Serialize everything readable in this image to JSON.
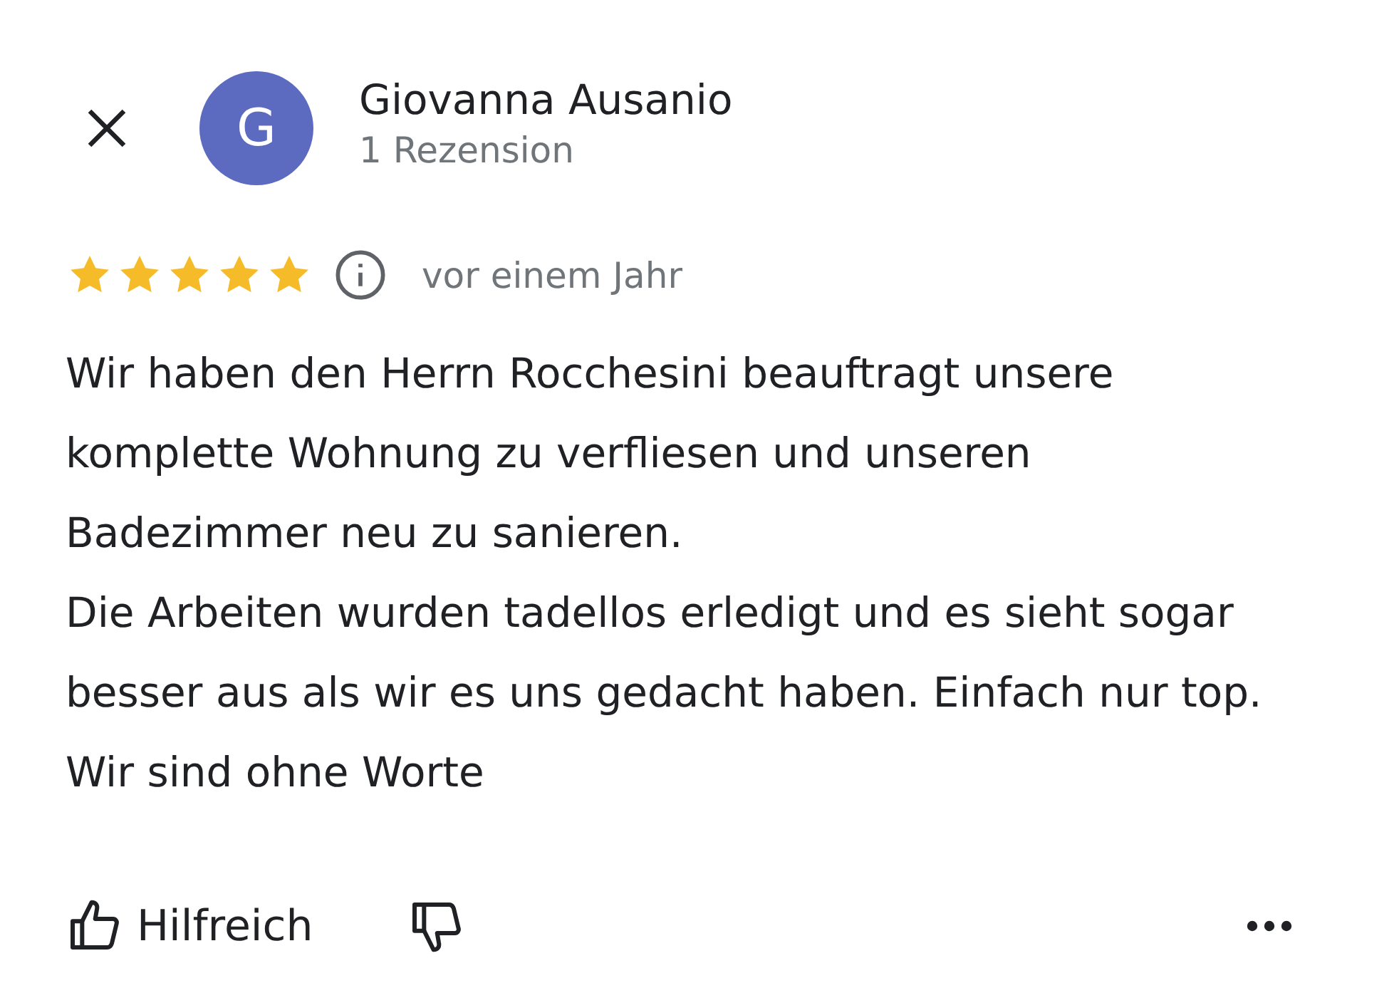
{
  "reviewer": {
    "avatar_letter": "G",
    "name": "Giovanna Ausanio",
    "review_count": "1 Rezension"
  },
  "review": {
    "stars": 5,
    "time": "vor einem Jahr",
    "paragraphs": [
      "Wir haben den Herrn Rocchesini beauftragt unsere komplette Wohnung zu verfliesen und unseren Badezimmer neu zu sanieren.",
      "Die Arbeiten wurden tadellos erledigt und es sieht sogar besser aus als wir es uns gedacht haben. Einfach nur top. Wir sind ohne Worte"
    ]
  },
  "actions": {
    "helpful_label": "Hilfreich"
  }
}
